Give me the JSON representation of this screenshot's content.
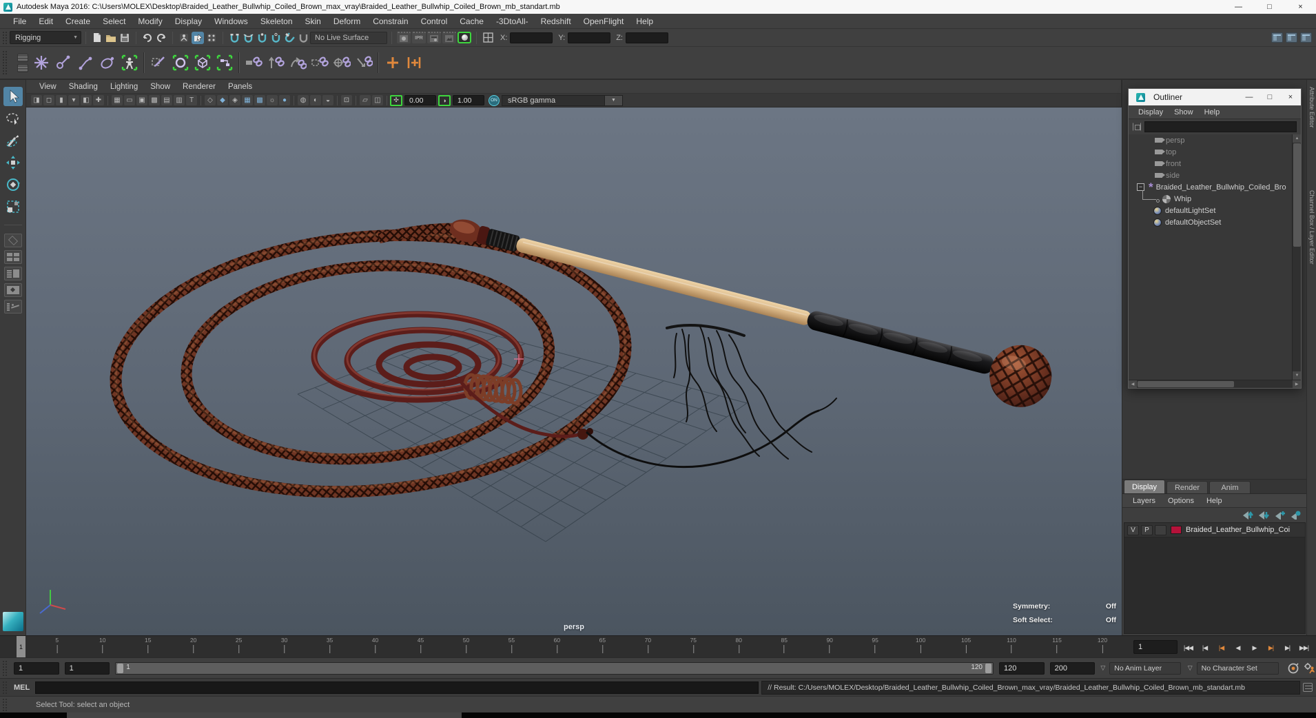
{
  "window": {
    "title": "Autodesk Maya 2016: C:\\Users\\MOLEX\\Desktop\\Braided_Leather_Bullwhip_Coiled_Brown_max_vray\\Braided_Leather_Bullwhip_Coiled_Brown_mb_standart.mb"
  },
  "icons": {
    "minimize": "—",
    "maximize": "□",
    "close": "×",
    "dropdown": "▼",
    "dropdown_outline": "▽",
    "expander_collapse": "−",
    "scroll_up": "▲",
    "scroll_down": "▼",
    "scroll_left": "◀",
    "scroll_right": "▶"
  },
  "menu_bar": [
    "File",
    "Edit",
    "Create",
    "Select",
    "Modify",
    "Display",
    "Windows",
    "Skeleton",
    "Skin",
    "Deform",
    "Constrain",
    "Control",
    "Cache",
    "-3DtoAll-",
    "Redshift",
    "OpenFlight",
    "Help"
  ],
  "status_line": {
    "menu_set": "Rigging",
    "live_surface": "No Live Surface",
    "ipr_label": "IPR",
    "x_label": "X:",
    "y_label": "Y:",
    "z_label": "Z:",
    "x_value": "",
    "y_value": "",
    "z_value": ""
  },
  "panel": {
    "menus": [
      "View",
      "Shading",
      "Lighting",
      "Show",
      "Renderer",
      "Panels"
    ],
    "exposure": "0.00",
    "gamma": "1.00",
    "on_label": "ON",
    "colorspace": "sRGB gamma"
  },
  "viewport": {
    "camera": "persp",
    "symmetry_label": "Symmetry:",
    "symmetry_value": "Off",
    "soft_select_label": "Soft Select:",
    "soft_select_value": "Off"
  },
  "outliner": {
    "title": "Outliner",
    "menus": [
      "Display",
      "Show",
      "Help"
    ],
    "search_value": "",
    "items": [
      {
        "label": "persp",
        "type": "camera",
        "muted": true
      },
      {
        "label": "top",
        "type": "camera",
        "muted": true
      },
      {
        "label": "front",
        "type": "camera",
        "muted": true
      },
      {
        "label": "side",
        "type": "camera",
        "muted": true
      },
      {
        "label": "Braided_Leather_Bullwhip_Coiled_Bro",
        "type": "transform",
        "expanded": true
      },
      {
        "label": "Whip",
        "type": "mesh",
        "child": true
      },
      {
        "label": "defaultLightSet",
        "type": "set"
      },
      {
        "label": "defaultObjectSet",
        "type": "set"
      }
    ]
  },
  "side_tabs": [
    "Attribute Editor",
    "Channel Box / Layer Editor"
  ],
  "layer_editor": {
    "tabs": [
      {
        "label": "Display",
        "active": true
      },
      {
        "label": "Render",
        "active": false
      },
      {
        "label": "Anim",
        "active": false
      }
    ],
    "menus": [
      "Layers",
      "Options",
      "Help"
    ],
    "layers": [
      {
        "visible": "V",
        "playback": "P",
        "name": "Braided_Leather_Bullwhip_Coi",
        "color": "#b5123a"
      }
    ]
  },
  "time_slider": {
    "current_frame": "1",
    "current_time_field": "1",
    "ticks": [
      5,
      10,
      15,
      20,
      25,
      30,
      35,
      40,
      45,
      50,
      55,
      60,
      65,
      70,
      75,
      80,
      85,
      90,
      95,
      100,
      105,
      110,
      115,
      120
    ],
    "frame_min": 1,
    "frame_max": 120,
    "playback": [
      {
        "name": "go-to-start-button",
        "glyph": "|◀◀",
        "accent": false
      },
      {
        "name": "step-back-frame-button",
        "glyph": "|◀",
        "accent": false
      },
      {
        "name": "step-back-key-button",
        "glyph": "|◀",
        "accent": true
      },
      {
        "name": "play-backwards-button",
        "glyph": "◀",
        "accent": false
      },
      {
        "name": "play-forward-button",
        "glyph": "▶",
        "accent": false
      },
      {
        "name": "step-forward-key-button",
        "glyph": "▶|",
        "accent": true
      },
      {
        "name": "step-forward-frame-button",
        "glyph": "▶|",
        "accent": false
      },
      {
        "name": "go-to-end-button",
        "glyph": "▶▶|",
        "accent": false
      }
    ]
  },
  "range_slider": {
    "anim_start": "1",
    "playback_start": "1",
    "range_label_start": "1",
    "range_label_end": "120",
    "playback_end": "120",
    "anim_end": "200",
    "anim_layer": "No Anim Layer",
    "character_set": "No Character Set"
  },
  "command_line": {
    "label": "MEL",
    "input_value": "",
    "result": "// Result: C:/Users/MOLEX/Desktop/Braided_Leather_Bullwhip_Coiled_Brown_max_vray/Braided_Leather_Bullwhip_Coiled_Brown_mb_standart.mb"
  },
  "help_line": {
    "text": "Select Tool: select an object"
  },
  "colors": {
    "selection_blue": "#5285a6",
    "shelf_purple": "#b2a3dc",
    "bracket_green": "#3ed63e",
    "teal": "#46b1c4",
    "accent_orange": "#e0883c",
    "layer_swatch": "#b5123a",
    "viewport_top": "#6c7684",
    "viewport_bottom": "#4b5560"
  }
}
